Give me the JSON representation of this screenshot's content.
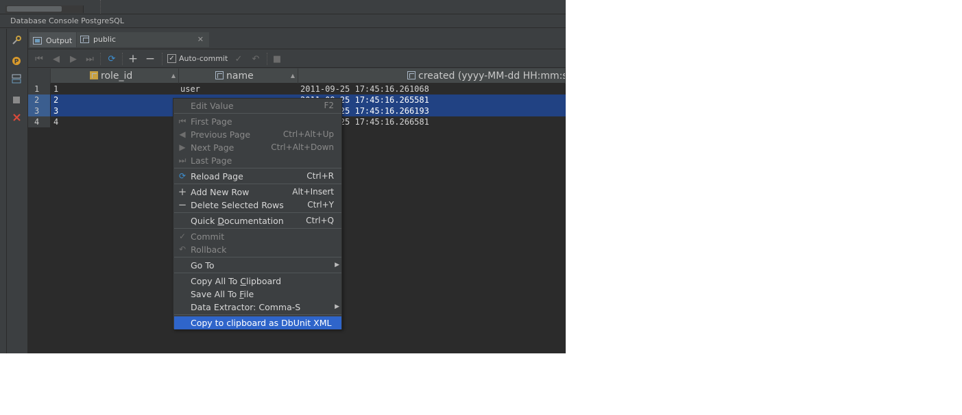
{
  "console": {
    "title": "Database Console PostgreSQL"
  },
  "tabs": [
    {
      "label": "Output",
      "active": true
    },
    {
      "label": "public",
      "active": false
    }
  ],
  "toolbar": {
    "autocommit_label": "Auto-commit",
    "autocommit_checked": true
  },
  "grid": {
    "columns": [
      {
        "label": "role_id",
        "icon": "key-column-icon"
      },
      {
        "label": "name",
        "icon": "column-icon"
      },
      {
        "label": "created (yyyy-MM-dd HH:mm:s",
        "icon": "column-icon"
      }
    ],
    "rows": [
      {
        "num": "1",
        "role_id": "1",
        "name": "user",
        "created": "2011-09-25 17:45:16.261068",
        "selected": false
      },
      {
        "num": "2",
        "role_id": "2",
        "name": "",
        "created": "2011-09-25 17:45:16.265581",
        "selected": true
      },
      {
        "num": "3",
        "role_id": "3",
        "name": "",
        "created": "2011-09-25 17:45:16.266193",
        "selected": true
      },
      {
        "num": "4",
        "role_id": "4",
        "name": "",
        "created": "2011-09-25 17:45:16.266581",
        "selected": false
      }
    ]
  },
  "context_menu": {
    "edit_value": {
      "label": "Edit Value",
      "shortcut": "F2"
    },
    "first_page": {
      "label": "First Page"
    },
    "previous_page": {
      "label": "Previous Page",
      "shortcut": "Ctrl+Alt+Up"
    },
    "next_page": {
      "label": "Next Page",
      "shortcut": "Ctrl+Alt+Down"
    },
    "last_page": {
      "label": "Last Page"
    },
    "reload_page": {
      "label": "Reload Page",
      "shortcut": "Ctrl+R"
    },
    "add_new_row": {
      "label": "Add New Row",
      "shortcut": "Alt+Insert"
    },
    "delete_selected_rows": {
      "label": "Delete Selected Rows",
      "shortcut": "Ctrl+Y"
    },
    "quick_documentation": {
      "label_pre": "Quick ",
      "label_u": "D",
      "label_post": "ocumentation",
      "shortcut": "Ctrl+Q"
    },
    "commit": {
      "label": "Commit"
    },
    "rollback": {
      "label": "Rollback"
    },
    "go_to": {
      "label": "Go To"
    },
    "copy_all": {
      "label_pre": "Copy All To ",
      "label_u": "C",
      "label_post": "lipboard"
    },
    "save_all": {
      "label_pre": "Save All To ",
      "label_u": "F",
      "label_post": "ile"
    },
    "data_extractor": {
      "label": "Data Extractor: Comma-S"
    },
    "copy_dbunit": {
      "label": "Copy to clipboard as DbUnit XML"
    }
  },
  "colors": {
    "selection": "#214283",
    "menu_highlight": "#2f65ca",
    "background": "#3c3f41",
    "grid_background": "#2b2b2b"
  }
}
